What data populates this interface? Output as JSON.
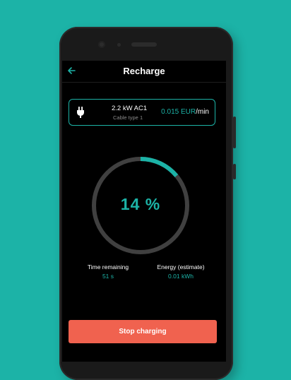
{
  "app": {
    "title": "Recharge"
  },
  "charger": {
    "power": "2.2 kW AC1",
    "cable": "Cable type 1",
    "price_amount": "0.015 EUR",
    "price_unit": "/min"
  },
  "progress": {
    "label": "14 %",
    "fraction": 0.14
  },
  "stats": {
    "time_label": "Time remaining",
    "time_value": "51 s",
    "energy_label": "Energy (estimate)",
    "energy_value": "0.01 kWh"
  },
  "actions": {
    "stop_label": "Stop charging"
  },
  "colors": {
    "accent": "#1cb3a7",
    "stop_button": "#f0624f",
    "ring_track": "#404040",
    "screen_bg": "#000000"
  },
  "icons": {
    "back": "arrow-left-icon",
    "plug": "plug-icon"
  }
}
